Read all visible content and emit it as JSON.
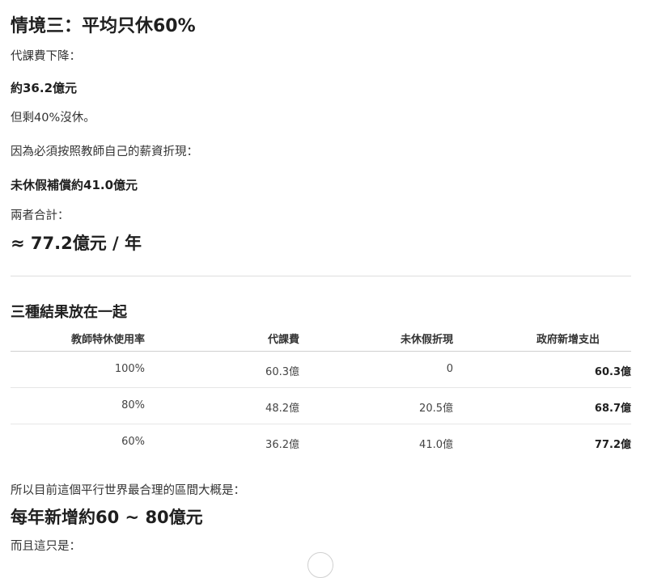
{
  "section": {
    "heading": "情境三：平均只休60%",
    "line1": "代課費下降：",
    "line2": "約36.2億元",
    "line3": "但剩40%沒休。",
    "line4": "因為必須按照教師自己的薪資折現：",
    "line5": "未休假補償約41.0億元",
    "line6": "兩者合計：",
    "total": "≈ 77.2億元 / 年"
  },
  "summary": {
    "heading": "三種結果放在一起",
    "columns": [
      "教師特休使用率",
      "代課費",
      "未休假折現",
      "政府新增支出"
    ],
    "rows": [
      [
        "100%",
        "60.3億",
        "0",
        "60.3億"
      ],
      [
        "80%",
        "48.2億",
        "20.5億",
        "68.7億"
      ],
      [
        "60%",
        "36.2億",
        "41.0億",
        "77.2億"
      ]
    ]
  },
  "conclusion": {
    "line1": "所以目前這個平行世界最合理的區間大概是：",
    "range": "每年新增約60 ~ 80億元",
    "line2": "而且這只是："
  }
}
